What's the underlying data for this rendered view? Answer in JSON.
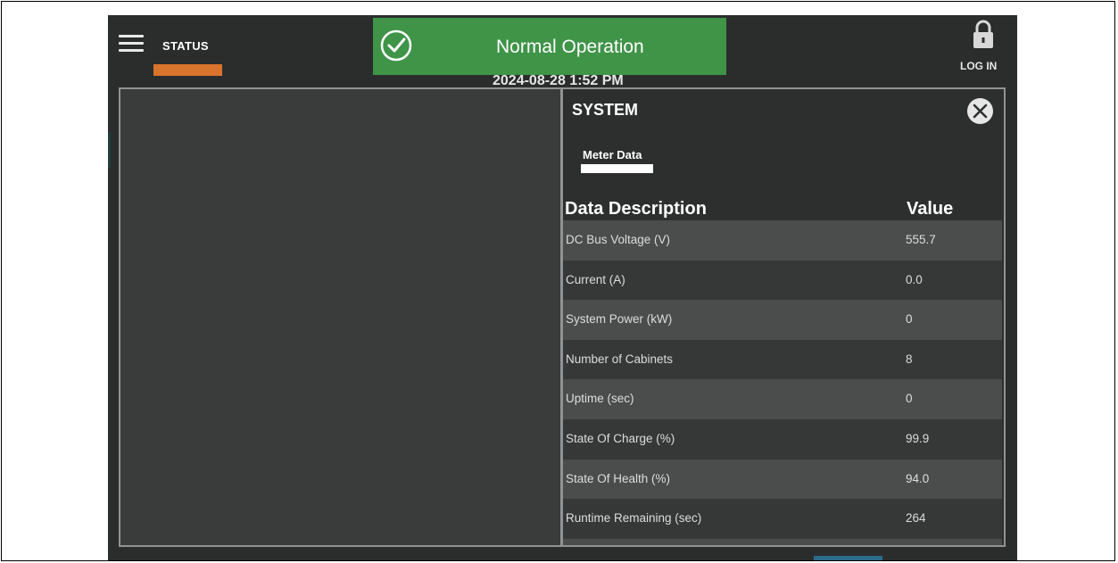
{
  "header": {
    "status_label": "STATUS",
    "banner_text": "Normal Operation",
    "datetime": "2024-08-28 1:52 PM",
    "login_label": "LOG IN"
  },
  "colors": {
    "status_accent": "#d9742d",
    "banner_bg": "#3f9448",
    "screen_bg": "#2b2d2d"
  },
  "icons": {
    "menu": "hamburger-icon",
    "status": "check-circle-icon",
    "login": "lock-icon",
    "close": "close-icon"
  },
  "system_panel": {
    "title": "SYSTEM",
    "tab_label": "Meter Data",
    "col_description": "Data Description",
    "col_value": "Value",
    "rows": [
      {
        "description": "DC Bus Voltage (V)",
        "value": "555.7"
      },
      {
        "description": "Current (A)",
        "value": "0.0"
      },
      {
        "description": "System Power (kW)",
        "value": "0"
      },
      {
        "description": "Number of Cabinets",
        "value": "8"
      },
      {
        "description": "Uptime (sec)",
        "value": "0"
      },
      {
        "description": "State Of Charge (%)",
        "value": "99.9"
      },
      {
        "description": "State Of Health (%)",
        "value": "94.0"
      },
      {
        "description": "Runtime Remaining (sec)",
        "value": "264"
      }
    ]
  }
}
